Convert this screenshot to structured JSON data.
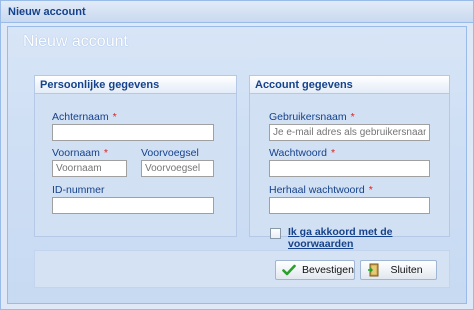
{
  "window": {
    "title": "Nieuw account"
  },
  "panel": {
    "title": "Nieuw account"
  },
  "personal": {
    "legend": "Persoonlijke gegevens",
    "lastname_label": "Achternaam",
    "lastname_value": "",
    "firstname_label": "Voornaam",
    "firstname_placeholder": "Voornaam",
    "prefix_label": "Voorvoegsel",
    "prefix_placeholder": "Voorvoegsel",
    "id_label": "ID-nummer",
    "id_value": "",
    "required_mark": "*"
  },
  "account": {
    "legend": "Account gegevens",
    "username_label": "Gebruikersnaam",
    "username_placeholder": "Je e-mail adres als gebruikersnaam",
    "password_label": "Wachtwoord",
    "repeat_label": "Herhaal wachtwoord",
    "terms_label": "Ik ga akkoord met de voorwaarden",
    "terms_checked": false,
    "required_mark": "*"
  },
  "buttons": {
    "confirm_label": "Bevestigen",
    "confirm_icon": "checkmark-icon",
    "close_label": "Sluiten",
    "close_icon": "door-exit-icon"
  },
  "colors": {
    "header_text": "#15428b",
    "required": "#e02020",
    "confirm_icon": "#2aa02a"
  }
}
